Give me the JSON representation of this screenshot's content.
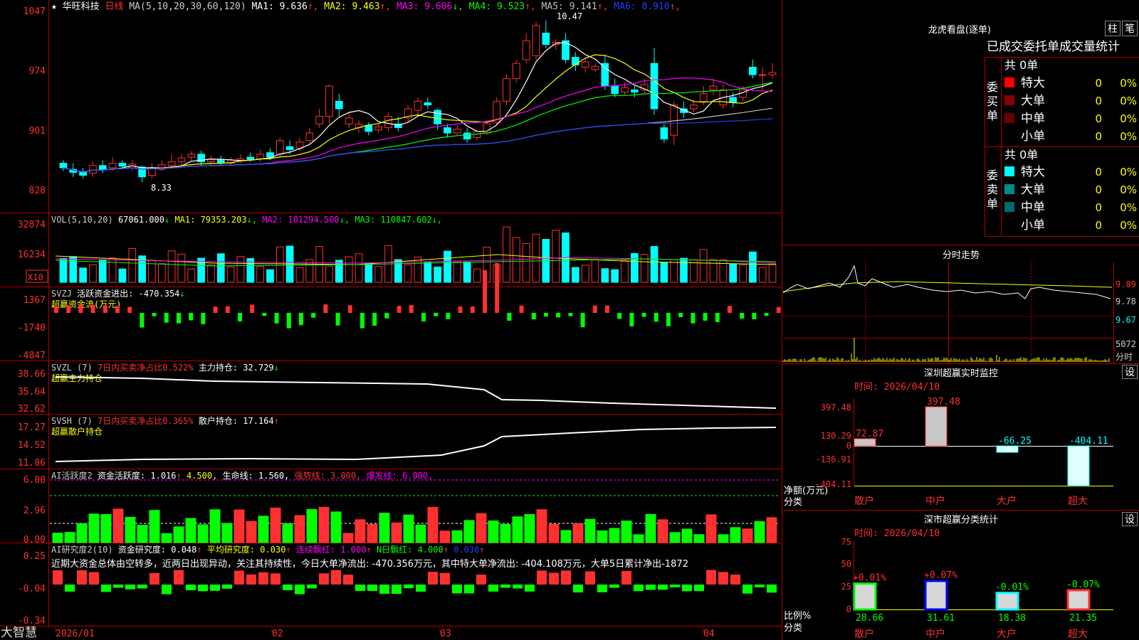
{
  "header": {
    "star": "★",
    "stock_name": "华旺科技",
    "period": "日线",
    "ma_params": "MA(5,10,20,30,60,120)",
    "ma_values": [
      {
        "label": "MA1:",
        "value": "9.636",
        "arrow": "↑",
        "color": "#ffffff"
      },
      {
        "label": "MA2:",
        "value": "9.463",
        "arrow": "↑",
        "color": "#ffff00"
      },
      {
        "label": "MA3:",
        "value": "9.606",
        "arrow": "↓",
        "color": "#ff00ff"
      },
      {
        "label": "MA4:",
        "value": "9.523",
        "arrow": "↑",
        "color": "#00ff00"
      },
      {
        "label": "MA5:",
        "value": "9.141",
        "arrow": "↑",
        "color": "#c0c0c0"
      },
      {
        "label": "MA6:",
        "value": "8.910",
        "arrow": "↑",
        "color": "#2040ff"
      }
    ]
  },
  "price_axis": [
    "1047",
    "974",
    "901",
    "828"
  ],
  "price_high_label": "10.47",
  "price_low_label": "8.33",
  "vol": {
    "title": "VOL(5,10,20)",
    "value": "67061.000",
    "arrow": "↓",
    "ma": [
      {
        "label": "MA1:",
        "value": "79353.203",
        "arrow": "↓",
        "color": "#ffff00"
      },
      {
        "label": "MA2:",
        "value": "101294.500",
        "arrow": "↓",
        "color": "#ff00ff"
      },
      {
        "label": "MA3:",
        "value": "110847.602",
        "arrow": "↓",
        "color": "#00ff00"
      }
    ],
    "axis": [
      "32874",
      "16234"
    ],
    "unit": "X10"
  },
  "svzj": {
    "title": "SVZJ",
    "line1": "活跃资金进出: -470.354",
    "arrow": "↓",
    "line2": "超赢资金流(万元)",
    "axis": [
      "1367",
      "-1740",
      "-4847"
    ]
  },
  "svzl": {
    "title": "SVZL (7)",
    "ratio": "7日内买卖净占比0.522%",
    "hold": "主力持仓: 32.729",
    "arrow": "↓",
    "line2": "超赢主力持仓",
    "axis": [
      "38.66",
      "35.64",
      "32.62"
    ]
  },
  "svsh": {
    "title": "SVSH (7)",
    "ratio": "7日内买卖净占比0.365%",
    "hold": "散户持仓: 17.164",
    "arrow": "↑",
    "line2": "超赢散户持仓",
    "axis": [
      "17.27",
      "14.52",
      "11.86"
    ]
  },
  "ai_active": {
    "title": "AI活跃度2",
    "t1": "资金活跃度: 1.016",
    "t2": "4.500,",
    "t3": "生命线: 1.560,",
    "t4": "强势线: 3.000,",
    "t5": "爆发线: 6.000,",
    "axis": [
      "6.00",
      "2.96",
      "0.00"
    ]
  },
  "ai_research": {
    "title": "AI研究度2(10)",
    "t1": "资金研究度: 0.048",
    "t2": "平均研究度: 0.030",
    "t3": "连续飘红: 1.000",
    "t4": "N日飘红: 4.000",
    "t5": "0.030",
    "comment": "近期大资金总体由空转多，近两日出现异动，关注其持续性，今日大单净流出: -470.356万元，其中特大单净流出: -404.108万元，大单5日累计净出-1872",
    "axis": [
      "0.25",
      "-0.04",
      "-0.34"
    ]
  },
  "date_axis": [
    "2026/01",
    "02",
    "03",
    "04"
  ],
  "brand": "大智慧",
  "right": {
    "lhb_title": "龙虎看盘(逐单)",
    "btn_zhu": "柱",
    "btn_bi": "笔",
    "tabs": "已成交委托单成交量统计",
    "buy_label": "委买单",
    "sell_label": "委卖单",
    "buy_total": "共 0单",
    "sell_total": "共 0单",
    "rows": [
      "特大",
      "大单",
      "中单",
      "小单"
    ],
    "buy_colors": [
      "#ff0000",
      "#8b0000",
      "#6b0000",
      "#000000"
    ],
    "sell_colors": [
      "#00ffff",
      "#008b8b",
      "#006b6b",
      "#000000"
    ],
    "zero": "0",
    "pct": "0%",
    "fenshi_title": "分时走势",
    "fenshi_axis": [
      "9.89",
      "9.78",
      "9.67",
      "5072",
      "分时"
    ],
    "sz_title": "深圳超赢实时监控",
    "sz_time": "时间: 2026/04/10",
    "sz_axis": [
      "397.48",
      "130.29",
      "0",
      "-136.91",
      "-404.11"
    ],
    "sz_values": [
      72.87,
      397.48,
      -66.25,
      -404.11
    ],
    "sz_labels": [
      "72.87",
      "397.48",
      "-66.25",
      "-404.11"
    ],
    "sz_ylabel": "净额(万元)",
    "sz_xlabel": "分类",
    "cats": [
      "散户",
      "中户",
      "大户",
      "超大"
    ],
    "set": "设",
    "fl_title": "深市超赢分类统计",
    "fl_time": "时间: 2026/04/10",
    "fl_axis": [
      "75",
      "50",
      "25",
      "0"
    ],
    "fl_values": [
      28.66,
      31.61,
      18.38,
      21.35
    ],
    "fl_labels": [
      "28.66",
      "31.61",
      "18.38",
      "21.35"
    ],
    "fl_changes": [
      "+0.01%",
      "+0.07%",
      "-0.01%",
      "-0.07%"
    ],
    "fl_ylabel": "比例%",
    "fl_xlabel": "分类"
  },
  "chart_data": {
    "type": "candlestick",
    "ylim": [
      8.2,
      10.55
    ],
    "candles": [
      [
        8.58,
        8.52,
        8.62,
        8.48
      ],
      [
        8.5,
        8.46,
        8.58,
        8.4
      ],
      [
        8.47,
        8.42,
        8.52,
        8.38
      ],
      [
        8.45,
        8.55,
        8.6,
        8.4
      ],
      [
        8.55,
        8.5,
        8.62,
        8.45
      ],
      [
        8.52,
        8.58,
        8.66,
        8.48
      ],
      [
        8.58,
        8.54,
        8.62,
        8.5
      ],
      [
        8.52,
        8.57,
        8.62,
        8.48
      ],
      [
        8.53,
        8.4,
        8.55,
        8.33
      ],
      [
        8.42,
        8.52,
        8.58,
        8.38
      ],
      [
        8.5,
        8.56,
        8.62,
        8.48
      ],
      [
        8.55,
        8.6,
        8.7,
        8.52
      ],
      [
        8.6,
        8.65,
        8.7,
        8.55
      ],
      [
        8.66,
        8.7,
        8.74,
        8.6
      ],
      [
        8.7,
        8.6,
        8.75,
        8.55
      ],
      [
        8.6,
        8.63,
        8.68,
        8.56
      ],
      [
        8.63,
        8.58,
        8.68,
        8.54
      ],
      [
        8.58,
        8.62,
        8.66,
        8.55
      ],
      [
        8.62,
        8.64,
        8.7,
        8.58
      ],
      [
        8.66,
        8.63,
        8.72,
        8.6
      ],
      [
        8.64,
        8.7,
        8.76,
        8.6
      ],
      [
        8.72,
        8.66,
        8.78,
        8.62
      ],
      [
        8.7,
        8.88,
        8.92,
        8.66
      ],
      [
        8.8,
        8.76,
        8.88,
        8.7
      ],
      [
        8.78,
        8.86,
        8.92,
        8.74
      ],
      [
        8.88,
        8.98,
        9.05,
        8.84
      ],
      [
        9.1,
        9.2,
        9.3,
        9.05
      ],
      [
        9.2,
        9.6,
        9.62,
        9.1
      ],
      [
        9.4,
        9.3,
        9.5,
        9.2
      ],
      [
        9.1,
        9.18,
        9.25,
        9.05
      ],
      [
        9.05,
        9.1,
        9.15,
        8.98
      ],
      [
        9.08,
        9.0,
        9.12,
        8.95
      ],
      [
        9.02,
        9.06,
        9.1,
        8.98
      ],
      [
        9.05,
        9.2,
        9.25,
        9.0
      ],
      [
        9.1,
        9.05,
        9.2,
        9.0
      ],
      [
        9.18,
        9.3,
        9.35,
        9.12
      ],
      [
        9.28,
        9.4,
        9.45,
        9.2
      ],
      [
        9.38,
        9.35,
        9.45,
        9.3
      ],
      [
        9.28,
        9.1,
        9.3,
        9.02
      ],
      [
        9.05,
        8.98,
        9.1,
        8.92
      ],
      [
        8.98,
        9.03,
        9.08,
        8.95
      ],
      [
        8.98,
        8.9,
        9.05,
        8.85
      ],
      [
        8.92,
        9.0,
        9.02,
        8.88
      ],
      [
        8.98,
        9.1,
        9.15,
        8.95
      ],
      [
        9.12,
        9.4,
        9.45,
        9.08
      ],
      [
        9.4,
        9.7,
        9.75,
        9.35
      ],
      [
        9.7,
        9.9,
        9.95,
        9.65
      ],
      [
        9.95,
        10.2,
        10.3,
        9.9
      ],
      [
        10.0,
        10.4,
        10.45,
        9.95
      ],
      [
        10.3,
        10.15,
        10.47,
        10.1
      ],
      [
        10.15,
        10.18,
        10.22,
        10.08
      ],
      [
        10.2,
        9.95,
        10.3,
        9.9
      ],
      [
        9.98,
        9.88,
        10.05,
        9.8
      ],
      [
        9.85,
        9.92,
        9.98,
        9.78
      ],
      [
        9.82,
        9.86,
        9.9,
        9.78
      ],
      [
        9.9,
        9.6,
        10.0,
        9.55
      ],
      [
        9.6,
        9.5,
        9.7,
        9.45
      ],
      [
        9.52,
        9.58,
        9.65,
        9.48
      ],
      [
        9.55,
        9.52,
        9.6,
        9.45
      ],
      [
        9.55,
        9.62,
        9.7,
        9.5
      ],
      [
        9.9,
        9.3,
        10.1,
        9.22
      ],
      [
        9.05,
        8.9,
        9.1,
        8.85
      ],
      [
        8.95,
        9.35,
        9.4,
        8.82
      ],
      [
        9.3,
        9.25,
        9.4,
        9.18
      ],
      [
        9.3,
        9.35,
        9.42,
        9.25
      ],
      [
        9.4,
        9.5,
        9.6,
        9.35
      ],
      [
        9.55,
        9.6,
        9.7,
        9.48
      ],
      [
        9.35,
        9.55,
        9.62,
        9.3
      ],
      [
        9.45,
        9.38,
        9.52,
        9.32
      ],
      [
        9.45,
        9.55,
        9.6,
        9.4
      ],
      [
        9.85,
        9.75,
        9.95,
        9.7
      ],
      [
        9.75,
        9.75,
        9.85,
        9.55
      ],
      [
        9.75,
        9.78,
        9.9,
        9.7
      ]
    ]
  }
}
